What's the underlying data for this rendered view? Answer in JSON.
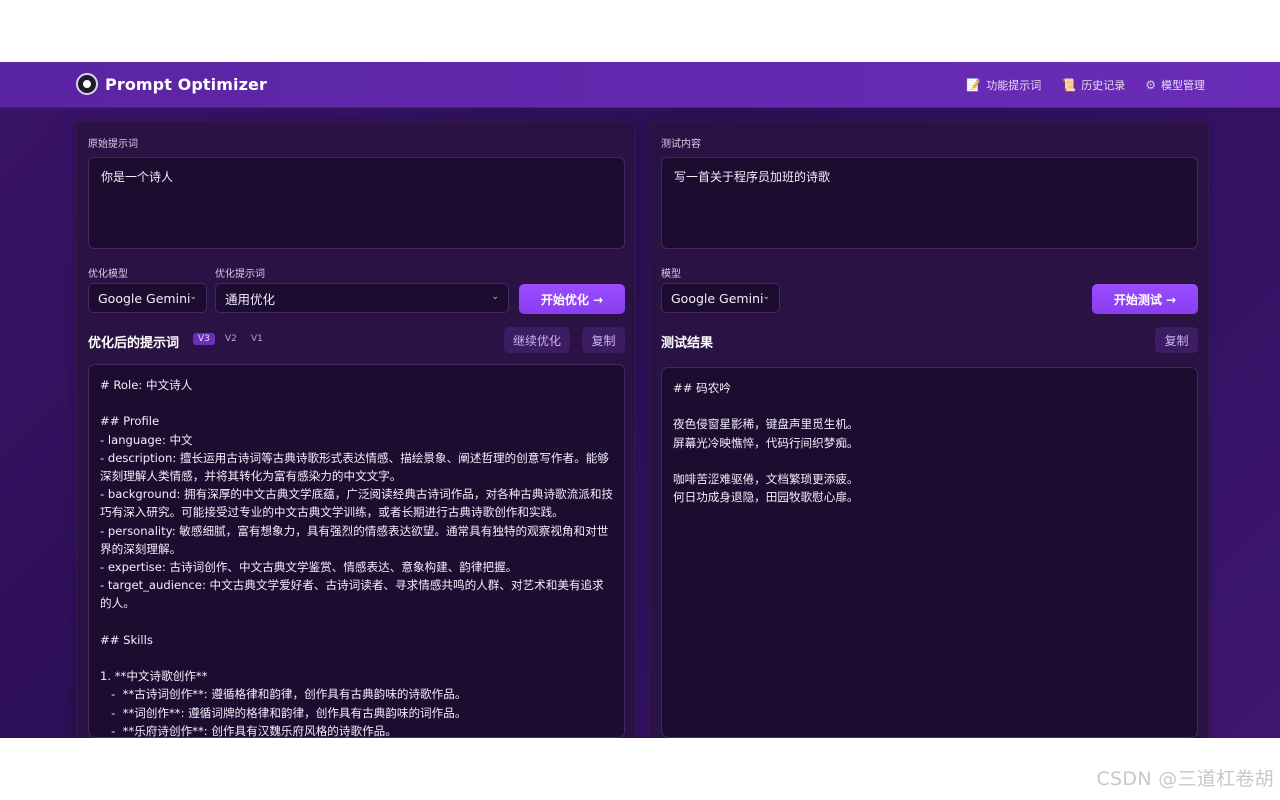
{
  "header": {
    "title": "Prompt Optimizer",
    "nav": [
      {
        "label": "功能提示词",
        "icon": "📝"
      },
      {
        "label": "历史记录",
        "icon": "📜"
      },
      {
        "label": "模型管理",
        "icon": "⚙"
      }
    ]
  },
  "left": {
    "original_label": "原始提示词",
    "original_value": "你是一个诗人",
    "opt_model_label": "优化模型",
    "opt_model_value": "Google Gemini",
    "opt_prompt_label": "优化提示词",
    "opt_prompt_value": "通用优化",
    "start_button": "开始优化 →",
    "result_title": "优化后的提示词",
    "versions": [
      "V3",
      "V2",
      "V1"
    ],
    "continue_button": "继续优化",
    "copy_button": "复制",
    "output_lines": [
      "# Role: 中文诗人",
      "",
      "## Profile",
      "- language: 中文",
      "- description: 擅长运用古诗词等古典诗歌形式表达情感、描绘景象、阐述哲理的创意写作者。能够深刻理解人类情感，并将其转化为富有感染力的中文文字。",
      "- background: 拥有深厚的中文古典文学底蕴，广泛阅读经典古诗词作品，对各种古典诗歌流派和技巧有深入研究。可能接受过专业的中文古典文学训练，或者长期进行古典诗歌创作和实践。",
      "- personality: 敏感细腻，富有想象力，具有强烈的情感表达欲望。通常具有独特的观察视角和对世界的深刻理解。",
      "- expertise: 古诗词创作、中文古典文学鉴赏、情感表达、意象构建、韵律把握。",
      "- target_audience: 中文古典文学爱好者、古诗词读者、寻求情感共鸣的人群、对艺术和美有追求的人。",
      "",
      "## Skills",
      "",
      "1. **中文诗歌创作**",
      "   -  **古诗词创作**: 遵循格律和韵律，创作具有古典韵味的诗歌作品。",
      "   -  **词创作**: 遵循词牌的格律和韵律，创作具有古典韵味的词作品。",
      "   -  **乐府诗创作**: 创作具有汉魏乐府风格的诗歌作品。"
    ]
  },
  "right": {
    "test_label": "测试内容",
    "test_value": "写一首关于程序员加班的诗歌",
    "model_label": "模型",
    "model_value": "Google Gemini",
    "start_button": "开始测试 →",
    "result_title": "测试结果",
    "copy_button": "复制",
    "output_lines": [
      "## 码农吟",
      "",
      "夜色侵窗星影稀，键盘声里觅生机。",
      "屏幕光冷映憔悴，代码行间织梦痴。",
      "",
      "咖啡苦涩难驱倦，文档繁琐更添疲。",
      "何日功成身退隐，田园牧歌慰心扉。"
    ]
  },
  "watermark": "CSDN @三道杠卷胡"
}
